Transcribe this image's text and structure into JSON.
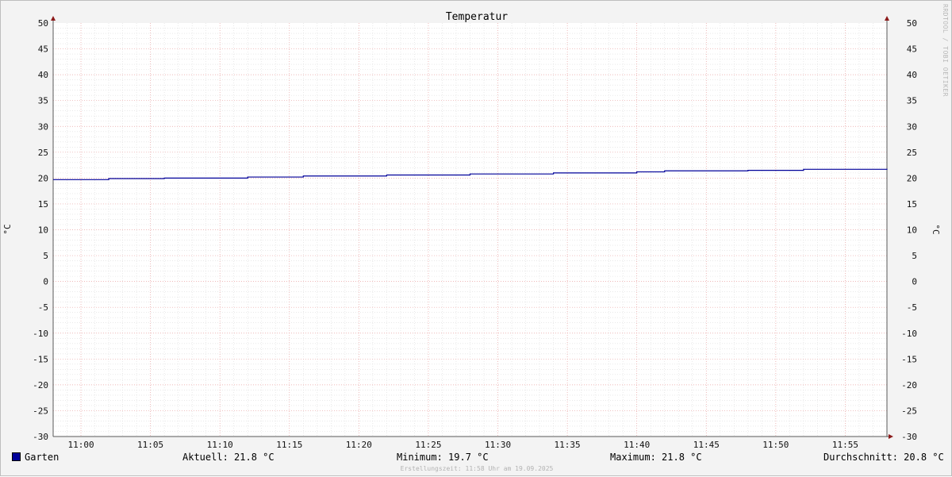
{
  "chart_data": {
    "type": "line",
    "title": "Temperatur",
    "ylabel": "°C",
    "ylabel_right": "°C",
    "ylim": [
      -30,
      50
    ],
    "yticks": [
      50,
      45,
      40,
      35,
      30,
      25,
      20,
      15,
      10,
      5,
      0,
      -5,
      -10,
      -15,
      -20,
      -25,
      -30
    ],
    "xlim": [
      "10:58",
      "11:58"
    ],
    "xtick_labels": [
      "11:00",
      "11:05",
      "11:10",
      "11:15",
      "11:20",
      "11:25",
      "11:30",
      "11:35",
      "11:40",
      "11:45",
      "11:50",
      "11:55"
    ],
    "grid": true,
    "series": [
      {
        "name": "Garten",
        "color": "#000099",
        "step": true,
        "x": [
          "10:58",
          "11:02",
          "11:06",
          "11:12",
          "11:16",
          "11:22",
          "11:28",
          "11:34",
          "11:40",
          "11:42",
          "11:48",
          "11:52",
          "11:58"
        ],
        "y": [
          19.7,
          19.9,
          20.0,
          20.2,
          20.4,
          20.6,
          20.8,
          21.0,
          21.2,
          21.4,
          21.5,
          21.7,
          21.8
        ]
      }
    ]
  },
  "legend": {
    "series_name": "Garten",
    "swatch_color": "#000099",
    "aktuell": "Aktuell: 21.8 °C",
    "minimum": "Minimum: 19.7 °C",
    "maximum": "Maximum: 21.8 °C",
    "durchschnitt": "Durchschnitt: 20.8 °C"
  },
  "footer": "Erstellungszeit: 11:58 Uhr am 19.09.2025",
  "watermark": "RRDTOOL / TOBI OETIKER"
}
